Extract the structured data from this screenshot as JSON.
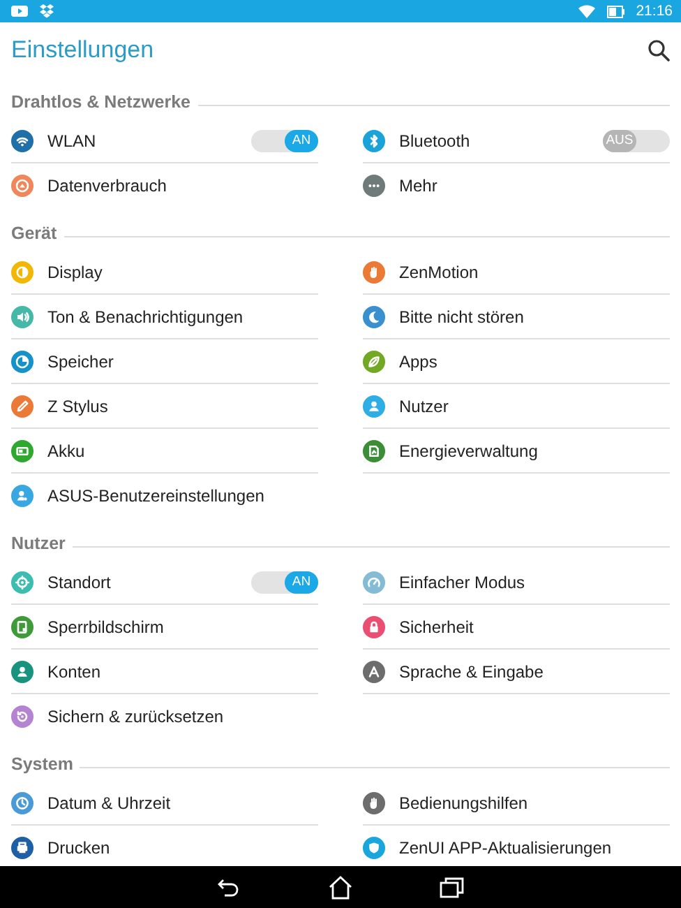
{
  "status_bar": {
    "time": "21:16"
  },
  "app_bar": {
    "title": "Einstellungen"
  },
  "sections": [
    {
      "title": "Drahtlos & Netzwerke",
      "items": [
        {
          "label": "WLAN",
          "color": "#1f6fa8",
          "kind": "toggle",
          "toggle": {
            "on": true,
            "label": "AN"
          }
        },
        {
          "label": "Bluetooth",
          "color": "#1ba2d8",
          "kind": "toggle",
          "toggle": {
            "on": false,
            "label": "AUS"
          }
        },
        {
          "label": "Datenverbrauch",
          "color": "#f0875a",
          "kind": "plain"
        },
        {
          "label": "Mehr",
          "color": "#6f7b78",
          "kind": "plain"
        }
      ]
    },
    {
      "title": "Gerät",
      "items": [
        {
          "label": "Display",
          "color": "#f2b705",
          "kind": "plain"
        },
        {
          "label": "ZenMotion",
          "color": "#ea7a35",
          "kind": "plain"
        },
        {
          "label": "Ton & Benachrichtigungen",
          "color": "#45b8a8",
          "kind": "plain"
        },
        {
          "label": "Bitte nicht stören",
          "color": "#3a8fcf",
          "kind": "plain"
        },
        {
          "label": "Speicher",
          "color": "#1592c9",
          "kind": "plain"
        },
        {
          "label": "Apps",
          "color": "#72a824",
          "kind": "plain"
        },
        {
          "label": "Z Stylus",
          "color": "#ea7a35",
          "kind": "plain"
        },
        {
          "label": "Nutzer",
          "color": "#2eaee5",
          "kind": "plain"
        },
        {
          "label": "Akku",
          "color": "#2fa82f",
          "kind": "plain"
        },
        {
          "label": "Energieverwaltung",
          "color": "#3b8e36",
          "kind": "plain"
        },
        {
          "label": "ASUS-Benutzereinstellungen",
          "color": "#3aa8e0",
          "kind": "plain"
        }
      ]
    },
    {
      "title": "Nutzer",
      "items": [
        {
          "label": "Standort",
          "color": "#3cbdb0",
          "kind": "toggle",
          "toggle": {
            "on": true,
            "label": "AN"
          }
        },
        {
          "label": "Einfacher Modus",
          "color": "#83bcd4",
          "kind": "plain"
        },
        {
          "label": "Sperrbildschirm",
          "color": "#3f9a3a",
          "kind": "plain"
        },
        {
          "label": "Sicherheit",
          "color": "#ea4f72",
          "kind": "plain"
        },
        {
          "label": "Konten",
          "color": "#17937e",
          "kind": "plain"
        },
        {
          "label": "Sprache & Eingabe",
          "color": "#6d6d6d",
          "kind": "plain"
        },
        {
          "label": "Sichern & zurücksetzen",
          "color": "#b483d2",
          "kind": "plain"
        }
      ]
    },
    {
      "title": "System",
      "items": [
        {
          "label": "Datum & Uhrzeit",
          "color": "#4a9ad8",
          "kind": "plain"
        },
        {
          "label": "Bedienungshilfen",
          "color": "#6d6d6d",
          "kind": "plain"
        },
        {
          "label": "Drucken",
          "color": "#1f5fa6",
          "kind": "plain"
        },
        {
          "label": "ZenUI APP-Aktualisierungen",
          "color": "#19a6dc",
          "kind": "plain"
        }
      ]
    }
  ]
}
